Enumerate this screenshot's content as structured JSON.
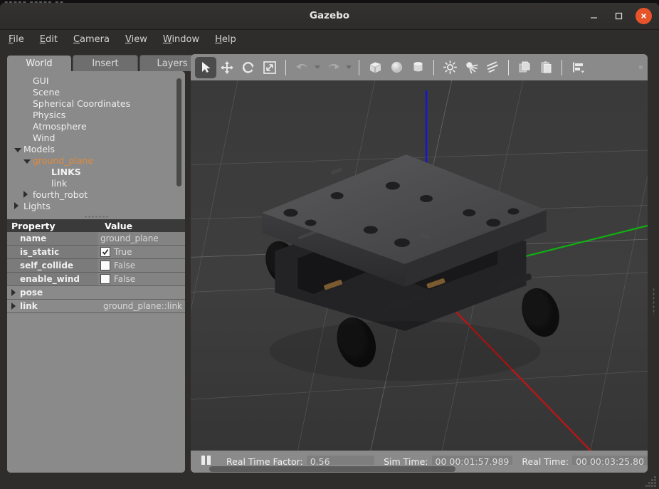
{
  "window": {
    "title": "Gazebo",
    "controls": {
      "minimize": "minimize-icon",
      "maximize": "maximize-icon",
      "close": "close-icon"
    }
  },
  "menubar": {
    "items": [
      {
        "label": "File",
        "accel": "F"
      },
      {
        "label": "Edit",
        "accel": "E"
      },
      {
        "label": "Camera",
        "accel": "C"
      },
      {
        "label": "View",
        "accel": "V"
      },
      {
        "label": "Window",
        "accel": "W"
      },
      {
        "label": "Help",
        "accel": "H"
      }
    ]
  },
  "left_panel": {
    "tabs": [
      {
        "label": "World",
        "active": true
      },
      {
        "label": "Insert",
        "active": false
      },
      {
        "label": "Layers",
        "active": false
      }
    ],
    "tree": [
      {
        "label": "GUI",
        "indent": 1,
        "caret": "none",
        "style": "normal"
      },
      {
        "label": "Scene",
        "indent": 1,
        "caret": "none",
        "style": "normal"
      },
      {
        "label": "Spherical Coordinates",
        "indent": 1,
        "caret": "none",
        "style": "normal"
      },
      {
        "label": "Physics",
        "indent": 1,
        "caret": "none",
        "style": "normal"
      },
      {
        "label": "Atmosphere",
        "indent": 1,
        "caret": "none",
        "style": "normal"
      },
      {
        "label": "Wind",
        "indent": 1,
        "caret": "none",
        "style": "normal"
      },
      {
        "label": "Models",
        "indent": 0,
        "caret": "expanded",
        "style": "normal"
      },
      {
        "label": "ground_plane",
        "indent": 1,
        "caret": "expanded",
        "style": "selected"
      },
      {
        "label": "LINKS",
        "indent": 3,
        "caret": "none",
        "style": "bold"
      },
      {
        "label": "link",
        "indent": 3,
        "caret": "none",
        "style": "normal"
      },
      {
        "label": "fourth_robot",
        "indent": 1,
        "caret": "collapsed",
        "style": "normal"
      },
      {
        "label": "Lights",
        "indent": 0,
        "caret": "collapsed",
        "style": "normal"
      }
    ],
    "property_table": {
      "headers": {
        "property": "Property",
        "value": "Value"
      },
      "rows": [
        {
          "name": "name",
          "value": "ground_plane",
          "kind": "text",
          "caret": "none"
        },
        {
          "name": "is_static",
          "value": "True",
          "kind": "checkbox",
          "checked": true,
          "caret": "none"
        },
        {
          "name": "self_collide",
          "value": "False",
          "kind": "checkbox",
          "checked": false,
          "caret": "none"
        },
        {
          "name": "enable_wind",
          "value": "False",
          "kind": "checkbox",
          "checked": false,
          "caret": "none"
        },
        {
          "name": "pose",
          "value": "",
          "kind": "text",
          "caret": "collapsed"
        },
        {
          "name": "link",
          "value": "ground_plane::link",
          "kind": "text",
          "caret": "collapsed"
        }
      ]
    }
  },
  "toolbar": {
    "items": [
      {
        "name": "select-mode-button",
        "icon": "cursor-arrow-icon",
        "active": true
      },
      {
        "name": "translate-mode-button",
        "icon": "move-arrows-icon",
        "active": false
      },
      {
        "name": "rotate-mode-button",
        "icon": "rotate-arrows-icon",
        "active": false
      },
      {
        "name": "scale-mode-button",
        "icon": "scale-arrows-icon",
        "active": false
      },
      {
        "name": "separator-1",
        "icon": "separator",
        "active": false
      },
      {
        "name": "undo-button",
        "icon": "undo-arrow-icon",
        "active": false
      },
      {
        "name": "undo-history-dropdown",
        "icon": "chevron-down-icon",
        "active": false
      },
      {
        "name": "redo-button",
        "icon": "redo-arrow-icon",
        "active": false
      },
      {
        "name": "redo-history-dropdown",
        "icon": "chevron-down-icon",
        "active": false
      },
      {
        "name": "separator-2",
        "icon": "separator",
        "active": false
      },
      {
        "name": "insert-box-button",
        "icon": "box-icon",
        "active": false
      },
      {
        "name": "insert-sphere-button",
        "icon": "sphere-icon",
        "active": false
      },
      {
        "name": "insert-cylinder-button",
        "icon": "cylinder-icon",
        "active": false
      },
      {
        "name": "separator-3",
        "icon": "separator",
        "active": false
      },
      {
        "name": "point-light-button",
        "icon": "point-light-icon",
        "active": false
      },
      {
        "name": "spot-light-button",
        "icon": "spot-light-icon",
        "active": false
      },
      {
        "name": "directional-light-button",
        "icon": "directional-light-icon",
        "active": false
      },
      {
        "name": "separator-4",
        "icon": "separator",
        "active": false
      },
      {
        "name": "copy-button",
        "icon": "copy-icon",
        "active": false
      },
      {
        "name": "paste-button",
        "icon": "paste-icon",
        "active": false
      },
      {
        "name": "separator-5",
        "icon": "separator",
        "active": false
      },
      {
        "name": "align-button",
        "icon": "align-icon",
        "active": false
      }
    ]
  },
  "viewport": {
    "background_color": "#3b3b3b",
    "ground_color": "#3d3d3d",
    "grid_color": "#9a9a9a",
    "axes": [
      {
        "name": "z-axis",
        "color": "#1414e0"
      },
      {
        "name": "y-axis",
        "color": "#10b010"
      },
      {
        "name": "x-axis",
        "color": "#c01414"
      }
    ],
    "model": "fourth_robot-rover"
  },
  "statusbar": {
    "pause_button": "pause-icon",
    "step_button": "step-dot-icon",
    "real_time_factor_label": "Real Time Factor:",
    "real_time_factor_value": "0.56",
    "sim_time_label": "Sim Time:",
    "sim_time_value": "00 00:01:57.989",
    "real_time_label": "Real Time:",
    "real_time_value": "00 00:03:25.80"
  }
}
